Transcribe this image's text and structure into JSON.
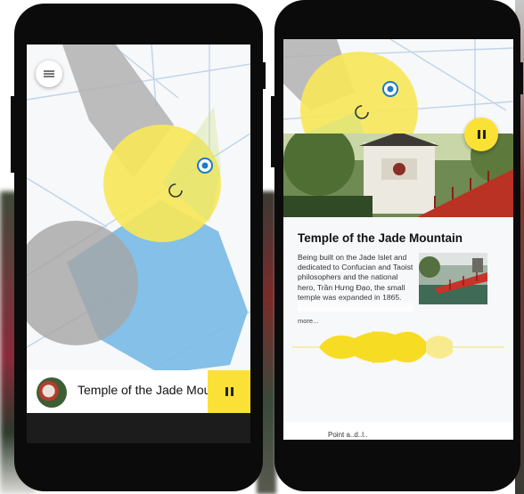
{
  "left_phone": {
    "now_playing": {
      "title": "Temple of the Jade Mountain",
      "pause_icon": "pause-icon"
    },
    "menu_icon": "hamburger-menu-icon"
  },
  "right_phone": {
    "poi": {
      "title": "Temple of the Jade Mountain",
      "description": "Being built on the Jade Islet and dedicated to Confucian and Taoist philosophers and the national hero, Trần Hưng Đạo, the small temple was expanded in 1865.",
      "more_label": "more..."
    },
    "footer_text": "Point a..d..l.."
  },
  "colors": {
    "accent_yellow": "#fbe135",
    "zone_blue": "#7dbde6",
    "zone_gray": "#a9a9a9",
    "phone_body": "#0b0b0b"
  }
}
